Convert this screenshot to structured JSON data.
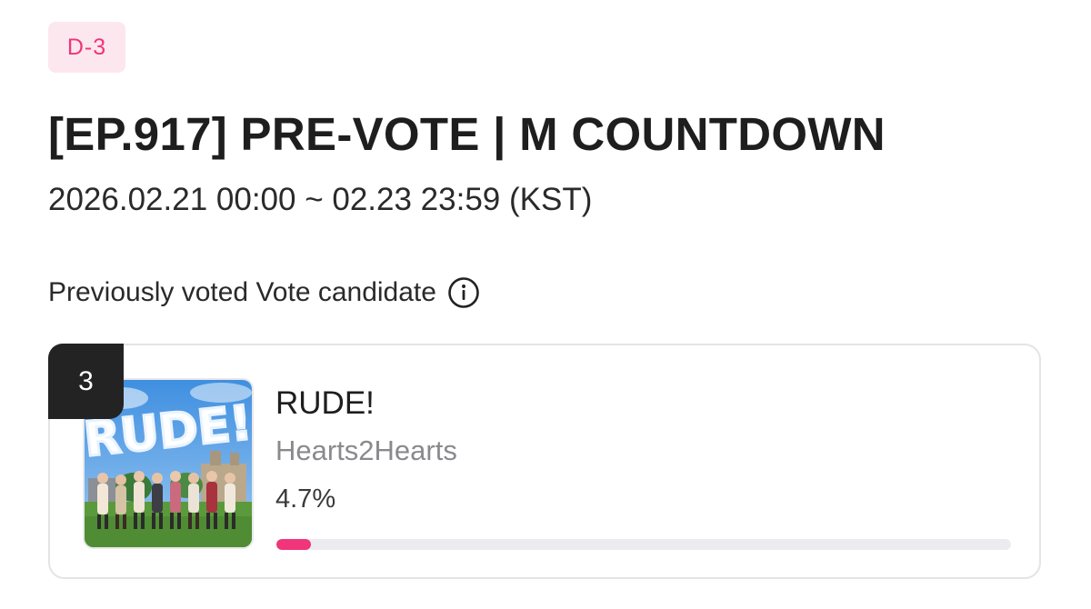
{
  "badge": {
    "dday": "D-3"
  },
  "header": {
    "title": "[EP.917] PRE-VOTE | M COUNTDOWN",
    "period": "2026.02.21 00:00 ~ 02.23 23:59 (KST)"
  },
  "section": {
    "label": "Previously voted Vote candidate",
    "info_icon": "info-circle-icon"
  },
  "candidate": {
    "rank": "3",
    "song": "RUDE!",
    "artist": "Hearts2Hearts",
    "percent_label": "4.7%",
    "vote_share": 0.047,
    "cover_art_text": "RUDE!"
  },
  "colors": {
    "accent": "#f0357a",
    "badge_bg": "#fde7ef",
    "rank_bg": "#232323",
    "track": "#ececef"
  }
}
